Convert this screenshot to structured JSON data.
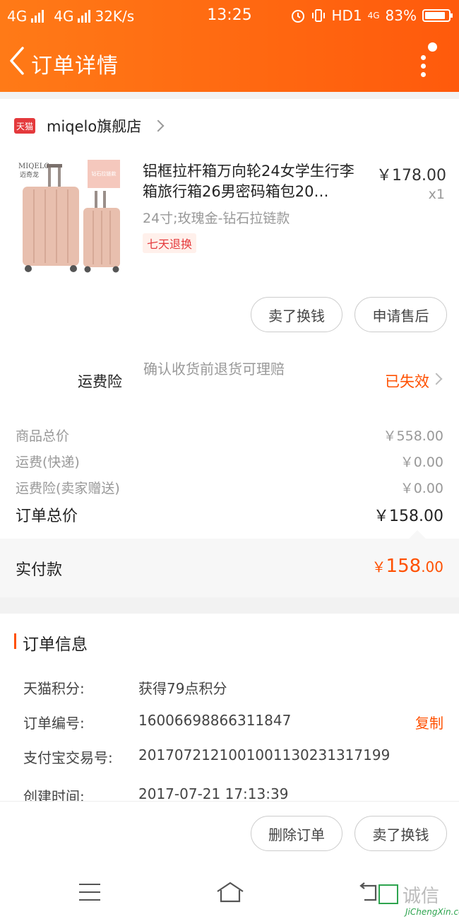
{
  "status_bar": {
    "net1": "4G",
    "net2": "4G",
    "speed": "32K/s",
    "time": "13:25",
    "hd": "HD1",
    "net3": "4G",
    "battery": "83%"
  },
  "nav": {
    "title": "订单详情"
  },
  "shop": {
    "badge": "天猫",
    "name": "miqelo旗舰店"
  },
  "product": {
    "image_brand": "MIQELO",
    "image_brand_cn": "迈奇龙",
    "image_tag": "钻石拉链款",
    "title": "铝框拉杆箱万向轮24女学生行李箱旅行箱26男密码箱包20…",
    "price": "￥178.00",
    "qty": "x1",
    "spec": "24寸;玫瑰金-钻石拉链款",
    "return_tag": "七天退换"
  },
  "buttons": {
    "sell_exchange": "卖了换钱",
    "after_sale": "申请售后",
    "delete_order": "删除订单"
  },
  "insurance": {
    "label": "运费险",
    "desc": "确认收货前退货可理赔",
    "status": "已失效"
  },
  "fees": [
    {
      "label": "商品总价",
      "value": "￥558.00"
    },
    {
      "label": "运费(快递)",
      "value": "￥0.00"
    },
    {
      "label": "运费险(卖家赠送)",
      "value": "￥0.00"
    },
    {
      "label": "订单总价",
      "value": "￥158.00"
    }
  ],
  "paid": {
    "label": "实付款",
    "currency": "￥",
    "integer": "158",
    "cents": ".00"
  },
  "order_info": {
    "title": "订单信息",
    "copy": "复制",
    "rows": [
      {
        "label": "天猫积分:",
        "value": "获得79点积分"
      },
      {
        "label": "订单编号:",
        "value": "16006698866311847"
      },
      {
        "label": "支付宝交易号:",
        "value": "2017072121001001130231317199"
      },
      {
        "label": "创建时间:",
        "value": "2017-07-21 17:13:39"
      }
    ]
  },
  "watermark": {
    "text": "诚信",
    "sub": "JiChengXin.com"
  },
  "colors": {
    "accent": "#ff5000",
    "header_start": "#ff7a17",
    "header_end": "#ff5a0c"
  }
}
